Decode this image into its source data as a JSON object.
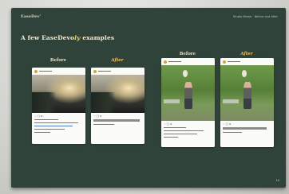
{
  "slide": {
    "brand": "EaseDev’",
    "header_right": "Studio Media · Before and After",
    "title_prefix": "A few EaseDevo",
    "title_accent": "ly",
    "title_suffix": " examples",
    "page_number": "10"
  },
  "examples": [
    {
      "before_label": "Before",
      "after_label": "After"
    },
    {
      "before_label": "Before",
      "after_label": "After"
    }
  ],
  "post_icons": "♡ ◯ ➤",
  "colors": {
    "slide_bg": "#2f433b",
    "title_text": "#efe9cf",
    "accent": "#f2d36b",
    "after_label": "#f0c25a"
  }
}
